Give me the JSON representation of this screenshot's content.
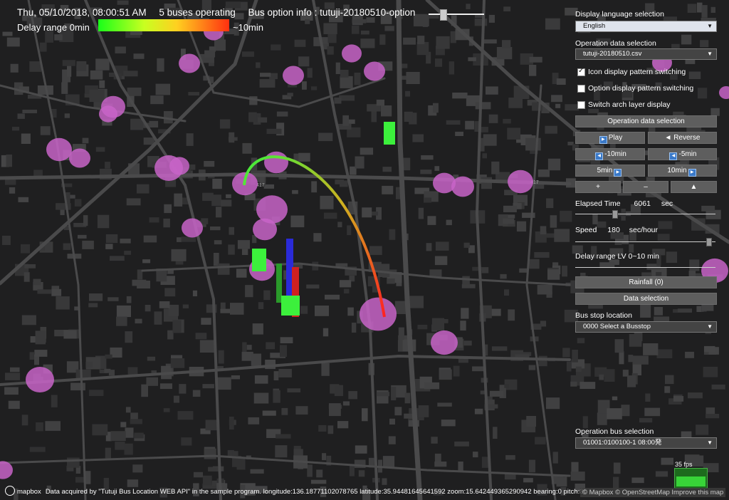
{
  "header": {
    "datetime": "Thu, 05/10/2018, 08:00:51 AM",
    "buses": "5 buses operating",
    "option_info": "Bus option info : tutuji-20180510-option"
  },
  "legend": {
    "label": "Delay range 0min",
    "max": "~10min",
    "gradient": [
      "#19ff19",
      "#ffd020",
      "#ff3010"
    ]
  },
  "panel": {
    "lang_label": "Display language selection",
    "lang_value": "English",
    "op_label": "Operation data selection",
    "op_value": "tutuji-20180510.csv",
    "chk_icon": "Icon display pattern switching",
    "chk_option": "Option display pattern switching",
    "chk_arch": "Switch arch layer display",
    "btn_opdata": "Operation data selection",
    "btn_play": "Play",
    "btn_reverse": "◄ Reverse",
    "btn_m10": "-10min",
    "btn_m5": "-5min",
    "btn_p5": "5min",
    "btn_p10": "10min",
    "btn_plus": "+",
    "btn_minus": "–",
    "btn_north": "▲",
    "elapsed_label": "Elapsed Time",
    "elapsed_value": "6061",
    "elapsed_unit": "sec",
    "speed_label": "Speed",
    "speed_value": "180",
    "speed_unit": "sec/hour",
    "delay_label": "Delay range LV 0~10 min",
    "btn_rainfall": "Rainfall (0)",
    "btn_data": "Data selection",
    "busstop_label": "Bus stop location",
    "busstop_value": "0000 Select a Busstop",
    "opbus_label": "Operation bus selection",
    "opbus_value": "01001:0100100-1 08:00発"
  },
  "fps": "35 fps",
  "footer": {
    "logo": "mapbox",
    "text": "Data acquired by \"Tutuji Bus Location WEB API\" in the sample program.  longitude:136.18771102078765  latitude:35.94481645641592  zoom:15.642449365290942  bearing:0  pitch:30",
    "attribution": "© Mapbox © OpenStreetMap  Improve this map"
  },
  "map_labels": {
    "road1": "417",
    "road2": "417"
  },
  "colors": {
    "stop_marker": "#c864c8",
    "bus": "#3cf03c",
    "route_start": "#3cf03c",
    "route_end": "#ff2020"
  }
}
